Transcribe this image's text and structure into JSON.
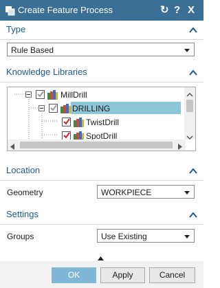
{
  "window": {
    "title": "Create Feature Process",
    "controls": {
      "refresh": "↻",
      "help": "?",
      "close": "X"
    }
  },
  "type_section": {
    "title": "Type",
    "selected": "Rule Based"
  },
  "knowledge_section": {
    "title": "Knowledge Libraries",
    "tree": [
      {
        "label": "MillDrill",
        "checked": "partial"
      },
      {
        "label": "DRILLING",
        "checked": "partial",
        "selected": true
      },
      {
        "label": "TwistDrill",
        "checked": "checked"
      },
      {
        "label": "SpotDrill",
        "checked": "checked"
      }
    ]
  },
  "location_section": {
    "title": "Location",
    "geometry_label": "Geometry",
    "geometry_value": "WORKPIECE"
  },
  "settings_section": {
    "title": "Settings",
    "groups_label": "Groups",
    "groups_value": "Use Existing"
  },
  "footer": {
    "ok": "OK",
    "apply": "Apply",
    "cancel": "Cancel"
  },
  "colors": {
    "titlebar": "#3a6f96",
    "section_title": "#1c5a8a",
    "selection": "#8cc6d8",
    "ok_button": "#7fb6d6"
  }
}
